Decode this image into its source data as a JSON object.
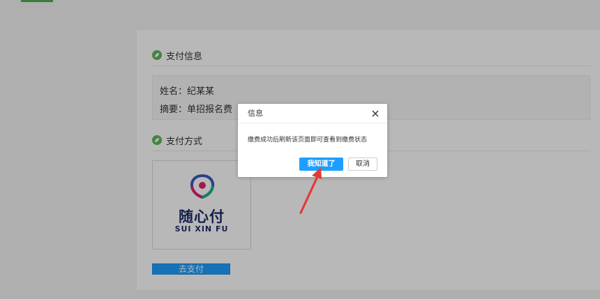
{
  "payment_info": {
    "title": "支付信息",
    "name_label": "姓名：",
    "name_value": "纪某某",
    "summary_label": "摘要：",
    "summary_value": "单招报名费"
  },
  "payment_method": {
    "title": "支付方式",
    "brand_name_cn": "随心付",
    "brand_name_en": "SUI XIN FU",
    "go_pay_label": "去支付"
  },
  "dialog": {
    "title": "信息",
    "message": "缴费成功后刷新该页面即可查看到缴费状态",
    "confirm_label": "我知道了",
    "cancel_label": "取消"
  },
  "colors": {
    "accent_blue": "#1e9fff",
    "section_icon_green": "#5cb85c",
    "brand_navy": "#1c2f6a",
    "annotation_red": "#e53935"
  },
  "icons": {
    "section": "leaf-icon",
    "close": "close-icon",
    "brand": "suixinfu-logo",
    "annotation": "red-arrow-annotation"
  }
}
